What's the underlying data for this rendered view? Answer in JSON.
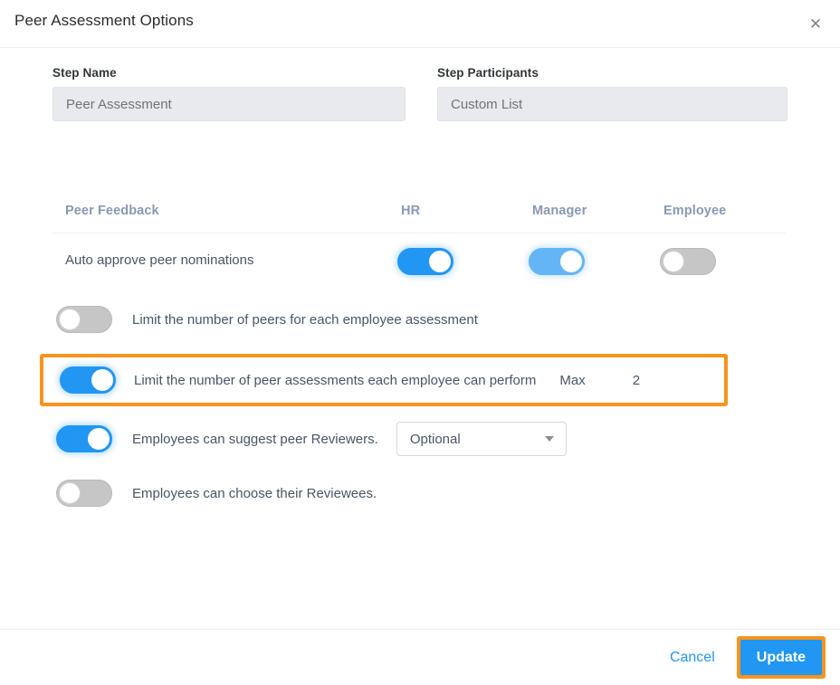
{
  "header": {
    "title": "Peer Assessment Options",
    "close_icon": "close-icon",
    "close_glyph": "✕"
  },
  "fields": {
    "step_name": {
      "label": "Step Name",
      "value": "Peer Assessment",
      "placeholder": "Peer Assessment"
    },
    "step_participants": {
      "label": "Step Participants",
      "value": "Custom List",
      "placeholder": "Custom List"
    }
  },
  "permission_table": {
    "columns": [
      "Peer Feedback",
      "HR",
      "Manager",
      "Employee"
    ],
    "rows": [
      {
        "label": "Auto approve peer nominations",
        "hr": true,
        "manager": true,
        "employee": false
      }
    ]
  },
  "options": [
    {
      "id": "limit-peers-per-assessment",
      "label": "Limit the number of peers for each employee assessment",
      "enabled": false,
      "highlighted": false
    },
    {
      "id": "limit-assessments-per-employee",
      "label": "Limit the number of peer assessments each employee can perform",
      "enabled": true,
      "highlighted": true,
      "max_label": "Max",
      "max_value": "2"
    },
    {
      "id": "suggest-peer-reviewers",
      "label": "Employees can suggest peer Reviewers.",
      "enabled": true,
      "highlighted": false,
      "dropdown": {
        "selected": "Optional",
        "caret_icon": "chevron-down-icon"
      }
    },
    {
      "id": "choose-reviewees",
      "label": "Employees can choose their Reviewees.",
      "enabled": false,
      "highlighted": false
    }
  ],
  "footer": {
    "cancel_label": "Cancel",
    "update_label": "Update"
  },
  "colors": {
    "accent_blue": "#2196f3",
    "accent_blue_light": "#64b5f6",
    "highlight_orange": "#f7941e",
    "toggle_off_gray": "#c6c6c6",
    "text_primary": "#4a5568",
    "header_text": "#8a99b3",
    "field_bg": "#e8eaed"
  }
}
